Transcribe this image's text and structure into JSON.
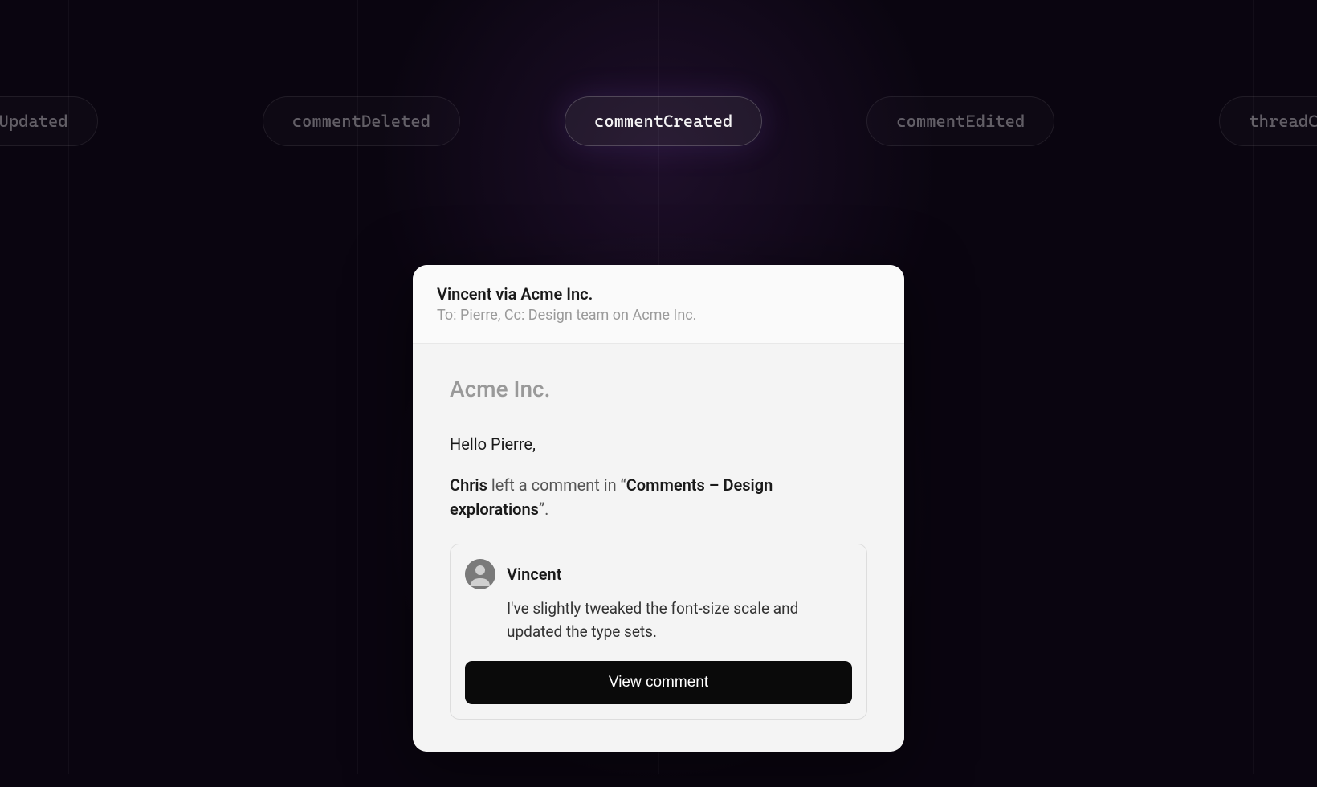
{
  "events": {
    "far_left": "adataUpdated",
    "left": "commentDeleted",
    "center": "commentCreated",
    "right": "commentEdited",
    "far_right": "threadCreate"
  },
  "email": {
    "from": "Vincent via Acme Inc.",
    "to": "To: Pierre, Cc: Design team on Acme Inc.",
    "company": "Acme Inc.",
    "greeting": "Hello Pierre,",
    "activity": {
      "actor": "Chris",
      "middle_text": " left a comment in “",
      "document": "Comments – Design explorations",
      "suffix": "”."
    },
    "comment": {
      "author": "Vincent",
      "text": "I've slightly tweaked the font-size scale and updated the type sets."
    },
    "button_label": "View comment"
  },
  "vlines": [
    85,
    445,
    820,
    1195,
    1560
  ]
}
